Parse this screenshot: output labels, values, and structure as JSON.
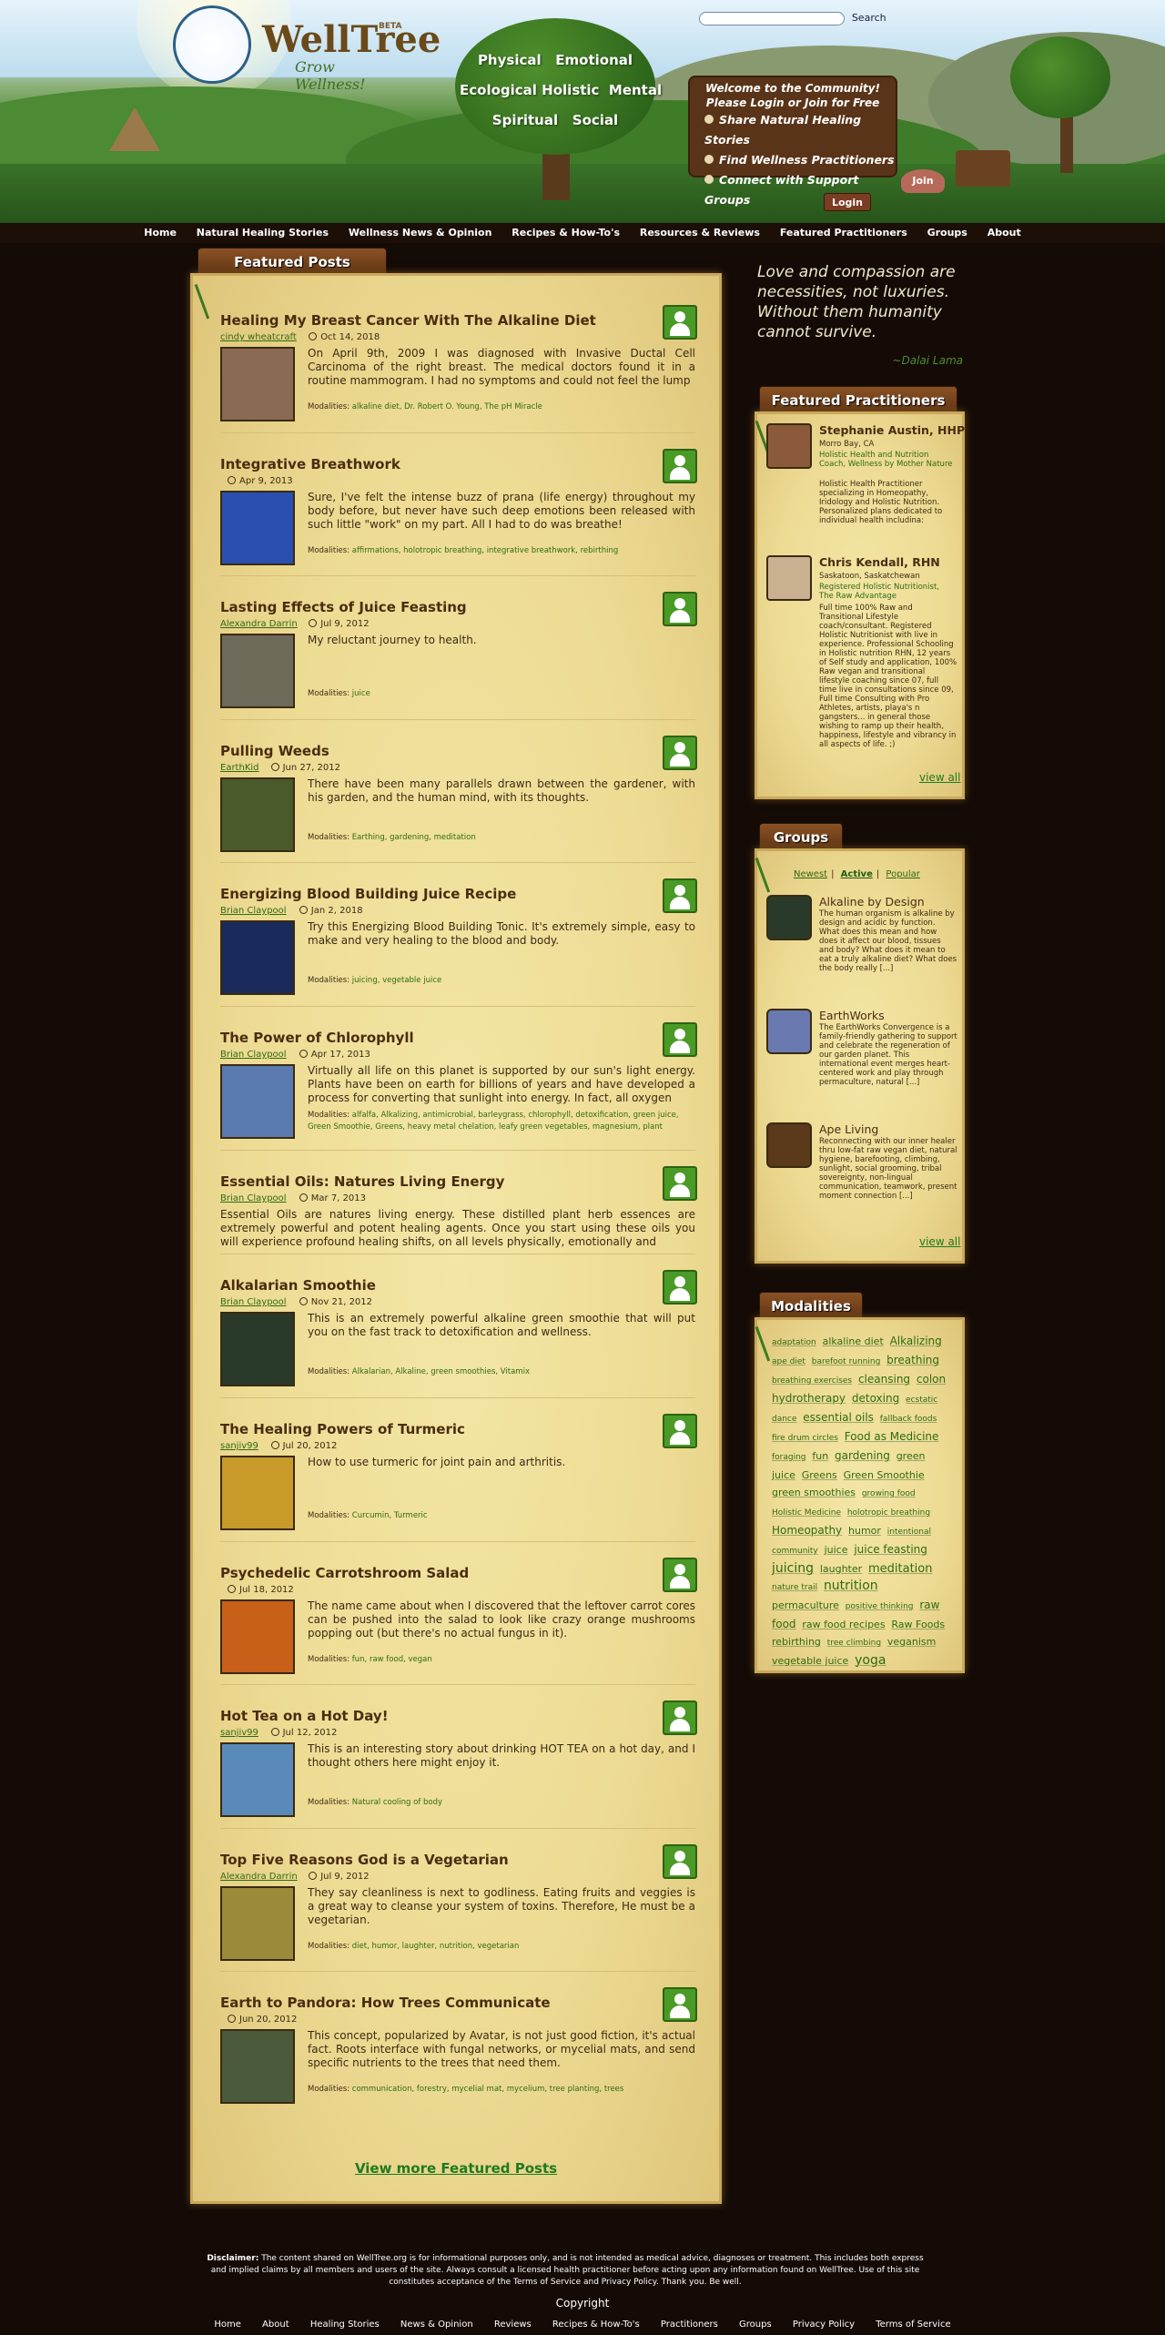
{
  "header": {
    "logo_name": "WellTree",
    "beta": "BETA",
    "tagline": "Grow Wellness!",
    "pillars": [
      [
        "Physical",
        "Emotional"
      ],
      [
        "Ecological",
        "Holistic",
        "Mental"
      ],
      [
        "Spiritual",
        "Social"
      ]
    ],
    "search_label": "Search",
    "search_value": "",
    "welcome_title": "Welcome to the Community!",
    "welcome_sub": "Please Login or Join for Free",
    "welcome_links": [
      "Share Natural Healing Stories",
      "Find Wellness Practitioners",
      "Connect with Support Groups"
    ],
    "login": "Login",
    "join": "Join"
  },
  "nav": [
    "Home",
    "Natural Healing Stories",
    "Wellness News & Opinion",
    "Recipes & How-To's",
    "Resources & Reviews",
    "Featured Practitioners",
    "Groups",
    "About"
  ],
  "featured_tab": "Featured Posts",
  "modalities_label": "Modalities:",
  "posts": [
    {
      "title": "Healing My Breast Cancer With The Alkaline Diet",
      "author": "cindy wheatcraft",
      "date": "Oct 14, 2018",
      "excerpt": "On April 9th, 2009 I was diagnosed with Invasive Ductal Cell Carcinoma of the right breast. The medical doctors found it in a routine mammogram. I had no symptoms and could not feel the lump",
      "modalities": "alkaline diet, Dr. Robert O. Young, The pH Miracle",
      "thumb": "#8a6a52"
    },
    {
      "title": "Integrative Breathwork",
      "author": "",
      "date": "Apr 9, 2013",
      "excerpt": "Sure, I've felt the intense buzz of prana (life energy) throughout my body before, but never have such deep emotions been released with such little \"work\" on my part. All I had to do was breathe!",
      "modalities": "affirmations, holotropic breathing, integrative breathwork, rebirthing",
      "thumb": "#2a4fb0"
    },
    {
      "title": "Lasting Effects of Juice Feasting",
      "author": "Alexandra Darrin",
      "date": "Jul 9, 2012",
      "excerpt": "My reluctant journey to health.",
      "modalities": "juice",
      "thumb": "#6e6a5a"
    },
    {
      "title": "Pulling Weeds",
      "author": "EarthKid",
      "date": "Jun 27, 2012",
      "excerpt": "There have been many parallels drawn between the gardener, with his garden, and the human mind, with its thoughts.",
      "modalities": "Earthing, gardening, meditation",
      "thumb": "#4a5a2a"
    },
    {
      "title": "Energizing Blood Building Juice Recipe",
      "author": "Brian Claypool",
      "date": "Jan 2, 2018",
      "excerpt": "Try this Energizing Blood Building Tonic. It's extremely simple, easy to make and very healing to the blood and body.",
      "modalities": "juicing, vegetable juice",
      "thumb": "#1a2a5a"
    },
    {
      "title": "The Power of Chlorophyll",
      "author": "Brian Claypool",
      "date": "Apr 17, 2013",
      "excerpt": "Virtually all life on this planet is supported by our sun's light energy. Plants have been on earth for billions of years and have developed a process for converting that sunlight into energy.  In fact, all oxygen",
      "modalities": "alfalfa, Alkalizing, antimicrobial, barleygrass, chlorophyll, detoxification, green juice, Green Smoothie, Greens, heavy metal chelation, leafy green vegetables, magnesium, plant",
      "thumb": "#5a7ab0"
    },
    {
      "title": "Essential Oils: Natures Living Energy",
      "author": "Brian Claypool",
      "date": "Mar 7, 2013",
      "excerpt": "Essential Oils are natures living energy. These distilled plant herb essences are extremely powerful and potent healing agents. Once you start using these oils you will experience profound healing shifts, on all levels physically, emotionally and",
      "modalities": "",
      "thumb": ""
    },
    {
      "title": "Alkalarian Smoothie",
      "author": "Brian Claypool",
      "date": "Nov 21, 2012",
      "excerpt": "This is an extremely powerful alkaline green smoothie that will put you on the fast track to detoxification and wellness.",
      "modalities": "Alkalarian, Alkaline, green smoothies, Vitamix",
      "thumb": "#2a3a2a"
    },
    {
      "title": "The Healing Powers of Turmeric",
      "author": "sanjiv99",
      "date": "Jul 20, 2012",
      "excerpt": "How to use turmeric for joint pain and arthritis.",
      "modalities": "Curcumin, Turmeric",
      "thumb": "#c89a2a"
    },
    {
      "title": "Psychedelic Carrotshroom Salad",
      "author": "",
      "date": "Jul 18, 2012",
      "excerpt": "The name came about when I discovered that the leftover carrot cores can be pushed into the salad to look like crazy orange mushrooms popping out (but there's no actual fungus in it).",
      "modalities": "fun, raw food, vegan",
      "thumb": "#c8601a"
    },
    {
      "title": "Hot Tea on a Hot Day!",
      "author": "sanjiv99",
      "date": "Jul 12, 2012",
      "excerpt": "This is an interesting story about drinking HOT TEA on a hot day, and I thought others here might enjoy it.",
      "modalities": "Natural cooling of body",
      "thumb": "#5a8aba"
    },
    {
      "title": "Top Five Reasons God is a Vegetarian",
      "author": "Alexandra Darrin",
      "date": "Jul 9, 2012",
      "excerpt": "They say cleanliness is next to godliness. Eating fruits and veggies is a great way to cleanse your system of toxins. Therefore, He must be a vegetarian.",
      "modalities": "diet, humor, laughter, nutrition, vegetarian",
      "thumb": "#9a8a3a"
    },
    {
      "title": "Earth to Pandora: How Trees Communicate",
      "author": "",
      "date": "Jun 20, 2012",
      "excerpt": "This concept, popularized by Avatar, is not just good fiction, it's actual fact. Roots interface with fungal networks, or mycelial mats, and send specific nutrients to the trees that need them.",
      "modalities": "communication, forestry, mycelial mat, mycelium, tree planting, trees",
      "thumb": "#4a5a3a"
    }
  ],
  "view_more": "View more Featured Posts",
  "quote": "Love and compassion are necessities, not luxuries. Without them humanity cannot survive.",
  "quote_by": "~Dalai Lama",
  "practitioners_tab": "Featured Practitioners",
  "practitioners": [
    {
      "name": "Stephanie Austin, HHP",
      "location": "Morro Bay, CA",
      "business": "Holistic Health and Nutrition Coach, Wellness by Mother Nature",
      "desc": "Holistic Health Practitioner specializing in Homeopathy, Iridology and Holistic Nutrition. Personalized plans dedicated to individual health includina:"
    },
    {
      "name": "Chris Kendall, RHN",
      "location": "Saskatoon, Saskatchewan",
      "business": "Registered Holistic Nutritionist, The Raw Advantage",
      "desc": "Full time 100% Raw and Transitional Lifestyle coach/consultant. Registered Holistic Nutritionist with live in experience. Professional Schooling in Holistic nutrition RHN, 12 years of Self study and application, 100% Raw vegan and transitional lifestyle coaching since 07, full time live in consultations since 09, Full time Consulting with Pro Athletes, artists, playa's n gangsters... in general those wishing to ramp up their health, happiness, lifestyle and vibrancy in all aspects of life. ;)"
    }
  ],
  "view_all": "view all",
  "groups_tab": "Groups",
  "group_tabs": [
    "Newest",
    "Active",
    "Popular"
  ],
  "groups": [
    {
      "name": "Alkaline by Design",
      "desc": "The human organism is alkaline by design and acidic by function. What does this mean and how does it affect our blood, tissues and body? What does it mean to eat a truly alkaline diet? What does the body really [...]"
    },
    {
      "name": "EarthWorks",
      "desc": "The EarthWorks Convergence is a family-friendly gathering to support and celebrate the regeneration of our garden planet. This international event merges heart-centered work and play through permaculture, natural [...]"
    },
    {
      "name": "Ape Living",
      "desc": "Reconnecting with our inner healer thru low-fat raw vegan diet, natural hygiene, barefooting, climbing, sunlight, social grooming, tribal sovereignty, non-lingual communication, teamwork, present moment connection [...]"
    }
  ],
  "modalities_tab": "Modalities",
  "tags": [
    [
      "adaptation",
      9
    ],
    [
      "alkaline diet",
      11
    ],
    [
      "Alkalizing",
      12
    ],
    [
      "ape diet",
      9
    ],
    [
      "barefoot running",
      9
    ],
    [
      "breathing",
      12
    ],
    [
      "breathing exercises",
      9
    ],
    [
      "cleansing",
      12
    ],
    [
      "colon hydrotherapy",
      12
    ],
    [
      "detoxing",
      12
    ],
    [
      "ecstatic dance",
      9
    ],
    [
      "essential oils",
      12
    ],
    [
      "fallback foods",
      9
    ],
    [
      "fire drum circles",
      9
    ],
    [
      "Food as Medicine",
      12
    ],
    [
      "foraging",
      9
    ],
    [
      "fun",
      11
    ],
    [
      "gardening",
      12
    ],
    [
      "green juice",
      11
    ],
    [
      "Greens",
      11
    ],
    [
      "Green Smoothie",
      11
    ],
    [
      "green smoothies",
      11
    ],
    [
      "growing food",
      9
    ],
    [
      "Holistic Medicine",
      9
    ],
    [
      "holotropic breathing",
      9
    ],
    [
      "Homeopathy",
      12
    ],
    [
      "humor",
      11
    ],
    [
      "intentional community",
      9
    ],
    [
      "juice",
      11
    ],
    [
      "juice feasting",
      12
    ],
    [
      "juicing",
      14
    ],
    [
      "laughter",
      11
    ],
    [
      "meditation",
      13
    ],
    [
      "nature trail",
      9
    ],
    [
      "nutrition",
      14
    ],
    [
      "permaculture",
      11
    ],
    [
      "positive thinking",
      9
    ],
    [
      "raw food",
      12
    ],
    [
      "raw food recipes",
      11
    ],
    [
      "Raw Foods",
      11
    ],
    [
      "rebirthing",
      11
    ],
    [
      "tree climbing",
      9
    ],
    [
      "veganism",
      11
    ],
    [
      "vegetable juice",
      11
    ],
    [
      "yoga",
      14
    ]
  ],
  "footer": {
    "disclaimer_label": "Disclaimer:",
    "disclaimer": "The content shared on WellTree.org is for informational purposes only, and is not intended as medical advice, diagnoses or treatment. This includes both express and implied claims by all members and users of the site. Always consult a licensed health practitioner before acting upon any information found on WellTree. Use of this site constitutes acceptance of the Terms of Service and Privacy Policy. Thank you. Be well.",
    "copyright": "Copyright",
    "links": [
      "Home",
      "About",
      "Healing Stories",
      "News & Opinion",
      "Reviews",
      "Recipes & How-To's",
      "Practitioners",
      "Groups",
      "Privacy Policy",
      "Terms of Service"
    ]
  },
  "colors": {
    "background": "#140b07",
    "parchment": "#eedc94",
    "link_green": "#2f6a12",
    "title_brown": "#4a2d10"
  }
}
